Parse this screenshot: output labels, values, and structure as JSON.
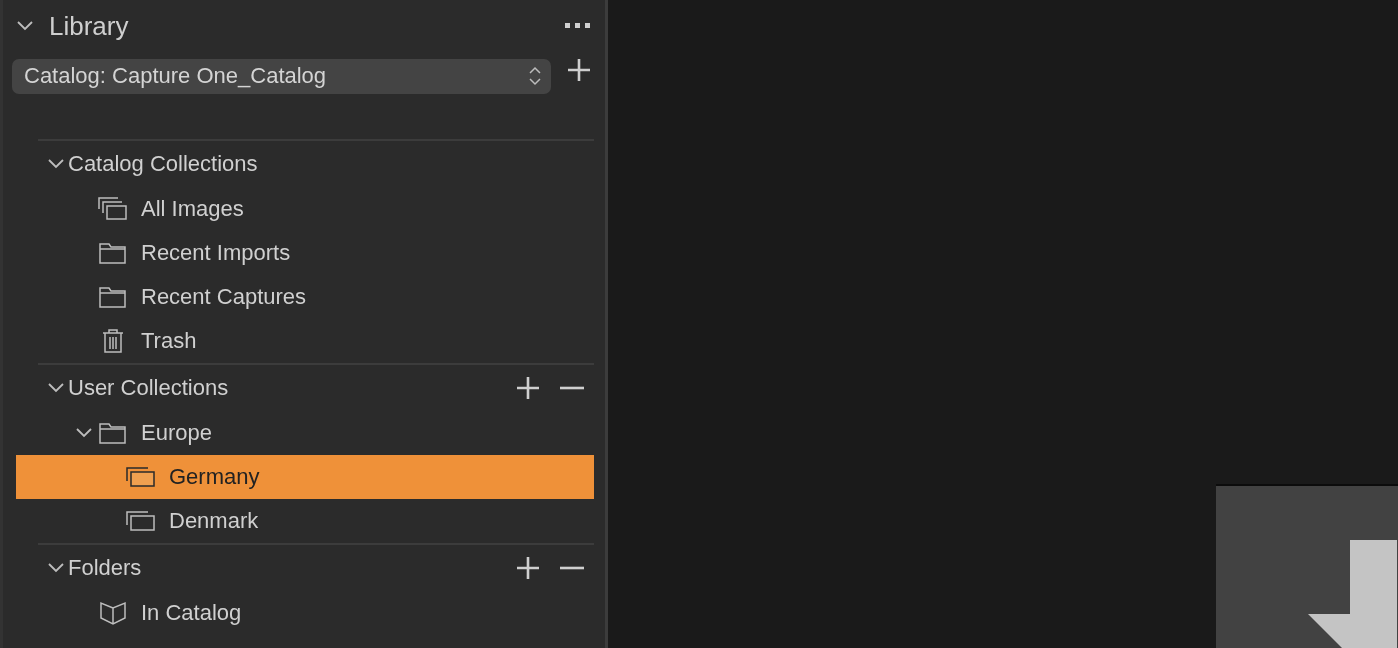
{
  "panel": {
    "title": "Library",
    "expanded": true,
    "catalog_select": "Catalog: Capture One_Catalog"
  },
  "sections": [
    {
      "title": "Catalog Collections",
      "expanded": true,
      "add_remove": false,
      "items": [
        {
          "label": "All Images",
          "kind": "stack",
          "selected": false
        },
        {
          "label": "Recent Imports",
          "kind": "folder",
          "selected": false
        },
        {
          "label": "Recent Captures",
          "kind": "folder",
          "selected": false
        },
        {
          "label": "Trash",
          "kind": "trash",
          "selected": false
        }
      ]
    },
    {
      "title": "User Collections",
      "expanded": true,
      "add_remove": true,
      "items": [
        {
          "label": "Europe",
          "kind": "folder",
          "selected": false,
          "expanded": true,
          "children": [
            {
              "label": "Germany",
              "kind": "album",
              "selected": true
            },
            {
              "label": "Denmark",
              "kind": "album",
              "selected": false
            }
          ]
        }
      ]
    },
    {
      "title": "Folders",
      "expanded": true,
      "add_remove": true,
      "items": [
        {
          "label": "In Catalog",
          "kind": "book",
          "selected": false
        }
      ]
    }
  ]
}
